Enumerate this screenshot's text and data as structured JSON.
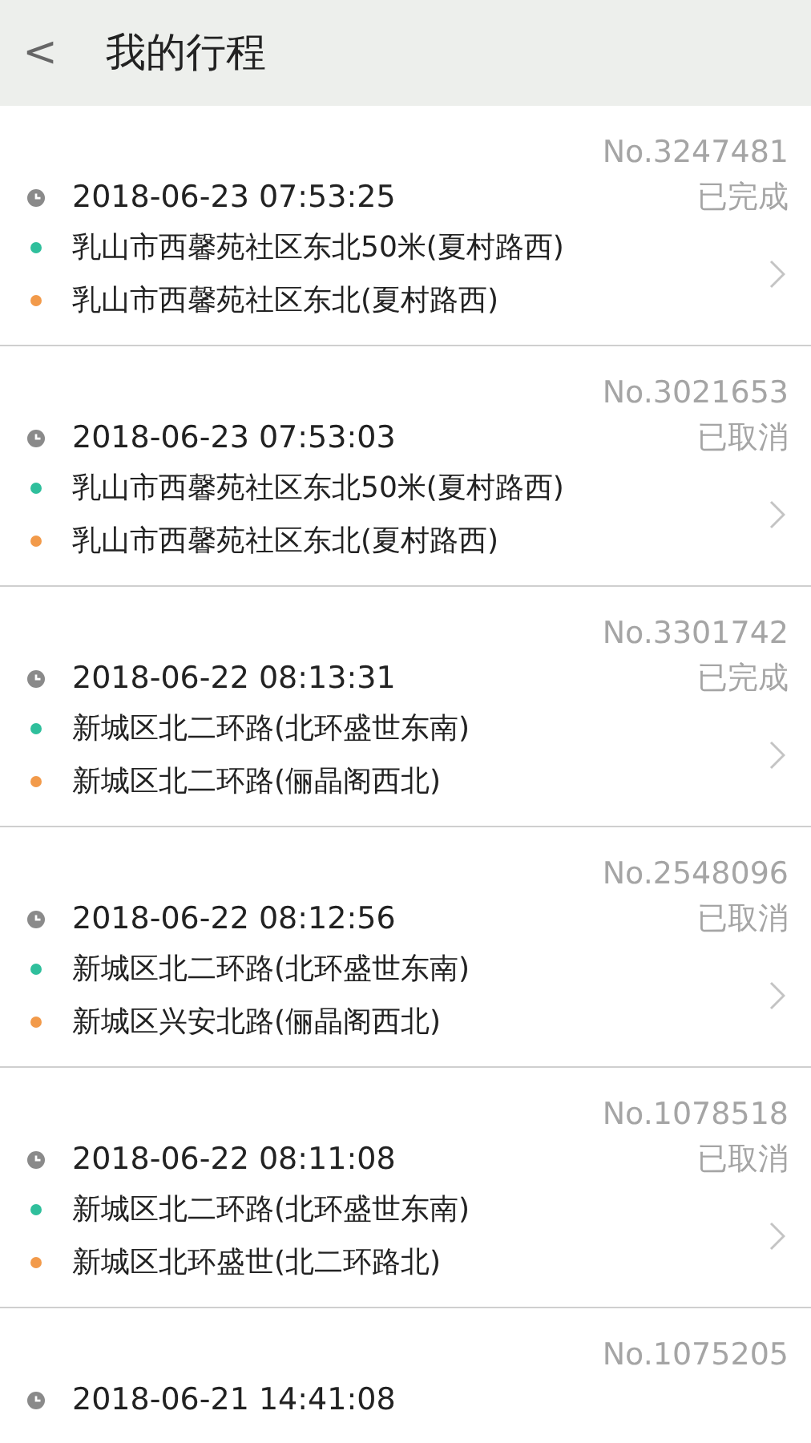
{
  "header": {
    "back": "<",
    "title": "我的行程"
  },
  "trips": [
    {
      "number": "No.3247481",
      "time": "2018-06-23 07:53:25",
      "status": "已完成",
      "origin": "乳山市西馨苑社区东北50米(夏村路西)",
      "destination": "乳山市西馨苑社区东北(夏村路西)"
    },
    {
      "number": "No.3021653",
      "time": "2018-06-23 07:53:03",
      "status": "已取消",
      "origin": "乳山市西馨苑社区东北50米(夏村路西)",
      "destination": "乳山市西馨苑社区东北(夏村路西)"
    },
    {
      "number": "No.3301742",
      "time": "2018-06-22 08:13:31",
      "status": "已完成",
      "origin": "新城区北二环路(北环盛世东南)",
      "destination": "新城区北二环路(俪晶阁西北)"
    },
    {
      "number": "No.2548096",
      "time": "2018-06-22 08:12:56",
      "status": "已取消",
      "origin": "新城区北二环路(北环盛世东南)",
      "destination": "新城区兴安北路(俪晶阁西北)"
    },
    {
      "number": "No.1078518",
      "time": "2018-06-22 08:11:08",
      "status": "已取消",
      "origin": "新城区北二环路(北环盛世东南)",
      "destination": "新城区北环盛世(北二环路北)"
    },
    {
      "number": "No.1075205",
      "time": "2018-06-21 14:41:08"
    }
  ]
}
